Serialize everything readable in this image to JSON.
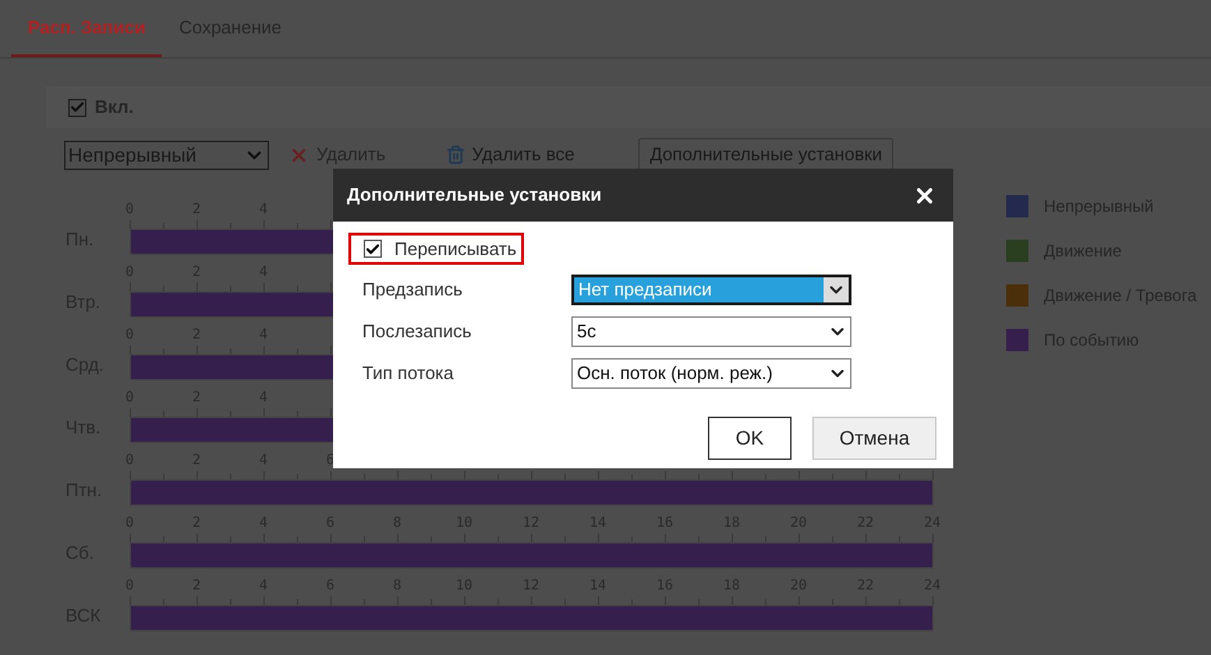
{
  "tabs": [
    {
      "label": "Расп. Записи",
      "selected": true
    },
    {
      "label": "Сохранение",
      "selected": false
    }
  ],
  "enable": {
    "label": "Вкл.",
    "checked": true
  },
  "toolbar": {
    "type_select": "Непрерывный",
    "delete": {
      "label": "Удалить",
      "disabled": true
    },
    "delete_all": {
      "label": "Удалить все",
      "disabled": false
    },
    "advanced_button": "Дополнительные установки"
  },
  "schedule": {
    "days": [
      {
        "label": "Пн.",
        "level": 1,
        "hour_labels": [
          "0",
          "2",
          "4"
        ]
      },
      {
        "label": "Втр.",
        "level": 1,
        "hour_labels": [
          "0",
          "2",
          "4"
        ]
      },
      {
        "label": "Срд.",
        "level": 1,
        "hour_labels": [
          "0",
          "2",
          "4"
        ]
      },
      {
        "label": "Чтв.",
        "level": 1,
        "hour_labels": [
          "0",
          "2",
          "4"
        ]
      },
      {
        "label": "Птн.",
        "level": 1,
        "hour_labels": [
          "0",
          "2",
          "4",
          "6"
        ]
      },
      {
        "label": "Сб.",
        "level": 1,
        "hour_labels": [
          "0",
          "2",
          "4",
          "6",
          "8",
          "10",
          "12",
          "14",
          "16",
          "18",
          "20",
          "22",
          "24"
        ]
      },
      {
        "label": "ВСК",
        "level": 1,
        "hour_labels": [
          "0",
          "2",
          "4",
          "6",
          "8",
          "10",
          "12",
          "14",
          "16",
          "18",
          "20",
          "22",
          "24"
        ]
      }
    ]
  },
  "legend": [
    {
      "label": "Непрерывный",
      "color": "#232a4d"
    },
    {
      "label": "Движение",
      "color": "#2a3f1f"
    },
    {
      "label": "Движение / Тревога",
      "color": "#4a2f0a"
    },
    {
      "label": "По событию",
      "color": "#35204d"
    }
  ],
  "dialog": {
    "title": "Дополнительные установки",
    "overwrite": {
      "label": "Переписывать",
      "checked": true,
      "highlighted": true
    },
    "fields": [
      {
        "label": "Предзапись",
        "value": "Нет предзаписи",
        "focused": true
      },
      {
        "label": "Послезапись",
        "value": "5с",
        "focused": false
      },
      {
        "label": "Тип потока",
        "value": "Осн. поток (норм. реж.)",
        "focused": false
      }
    ],
    "buttons": [
      {
        "label": "OK",
        "kind": "primary"
      },
      {
        "label": "Отмена",
        "kind": "secondary"
      }
    ]
  }
}
